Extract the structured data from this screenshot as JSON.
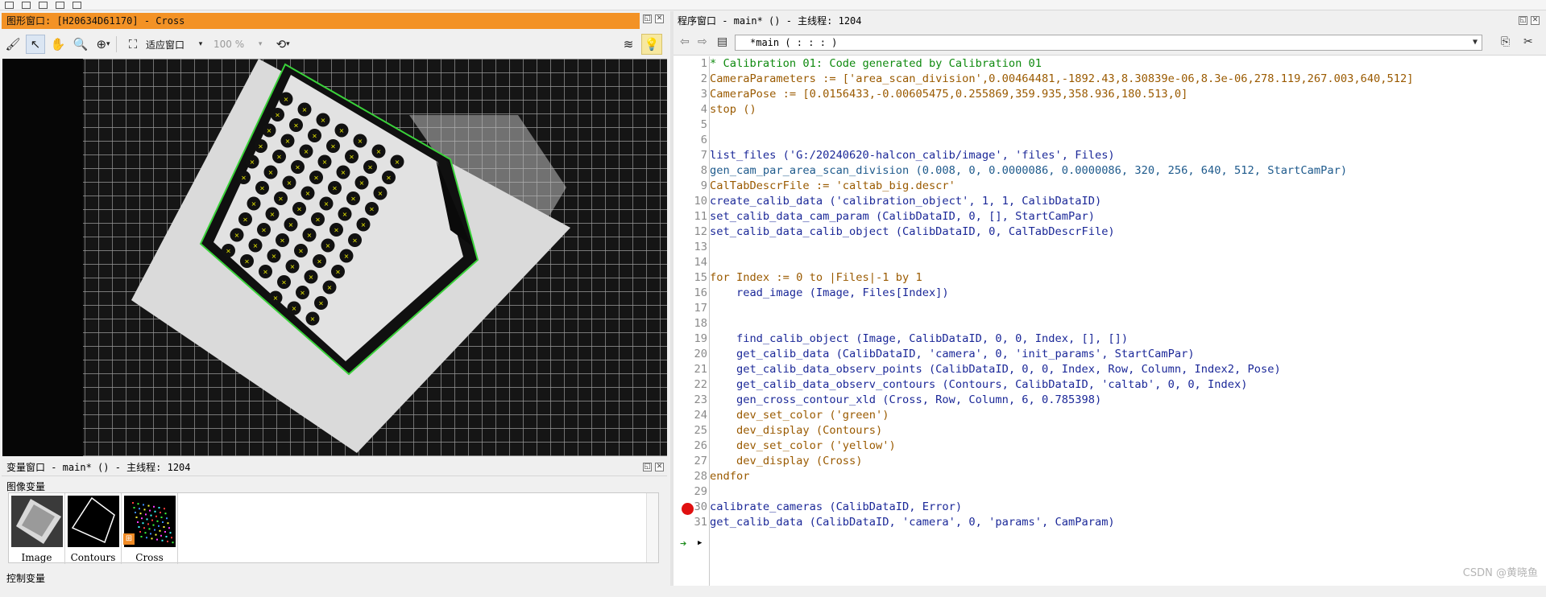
{
  "graphics_window": {
    "title": "图形窗口: [H20634D61170] - Cross",
    "fit_label": "适应窗口",
    "zoom_label": "100 %",
    "colors": {
      "title_bg": "#f39225",
      "outline": "#3ad23a",
      "marker": "#f2f200"
    }
  },
  "variable_window": {
    "title": "变量窗口 - main* () - 主线程: 1204",
    "section_image": "图像变量",
    "section_control": "控制变量",
    "items": [
      {
        "label": "Image"
      },
      {
        "label": "Contours"
      },
      {
        "label": "Cross"
      }
    ]
  },
  "program_window": {
    "title": "程序窗口 - main* () - 主线程: 1204",
    "procedure": "*main ( : : : )",
    "lines": [
      {
        "n": "1",
        "type": "comment",
        "text": "* Calibration 01: Code generated by Calibration 01"
      },
      {
        "n": "2",
        "type": "ctrl",
        "text": "CameraParameters := ['area_scan_division',0.00464481,-1892.43,8.30839e-06,8.3e-06,278.119,267.003,640,512]"
      },
      {
        "n": "3",
        "type": "ctrl",
        "text": "CameraPose := [0.0156433,-0.00605475,0.255869,359.935,358.936,180.513,0]"
      },
      {
        "n": "4",
        "type": "ctrl",
        "text": "stop ()"
      },
      {
        "n": "5",
        "type": "op",
        "text": ""
      },
      {
        "n": "6",
        "type": "op",
        "text": ""
      },
      {
        "n": "7",
        "type": "op",
        "text": "list_files ('G:/20240620-halcon_calib/image', 'files', Files)"
      },
      {
        "n": "8",
        "type": "norm",
        "text": "gen_cam_par_area_scan_division (0.008, 0, 0.0000086, 0.0000086, 320, 256, 640, 512, StartCamPar)"
      },
      {
        "n": "9",
        "type": "ctrl",
        "text": "CalTabDescrFile := 'caltab_big.descr'"
      },
      {
        "n": "10",
        "type": "op",
        "text": "create_calib_data ('calibration_object', 1, 1, CalibDataID)"
      },
      {
        "n": "11",
        "type": "op",
        "text": "set_calib_data_cam_param (CalibDataID, 0, [], StartCamPar)"
      },
      {
        "n": "12",
        "type": "op",
        "text": "set_calib_data_calib_object (CalibDataID, 0, CalTabDescrFile)"
      },
      {
        "n": "13",
        "type": "op",
        "text": ""
      },
      {
        "n": "14",
        "type": "op",
        "text": ""
      },
      {
        "n": "15",
        "type": "ctrl",
        "text": "for Index := 0 to |Files|-1 by 1"
      },
      {
        "n": "16",
        "type": "op",
        "text": "    read_image (Image, Files[Index])"
      },
      {
        "n": "17",
        "type": "op",
        "text": ""
      },
      {
        "n": "18",
        "type": "op",
        "text": ""
      },
      {
        "n": "19",
        "type": "op",
        "text": "    find_calib_object (Image, CalibDataID, 0, 0, Index, [], [])"
      },
      {
        "n": "20",
        "type": "op",
        "text": "    get_calib_data (CalibDataID, 'camera', 0, 'init_params', StartCamPar)"
      },
      {
        "n": "21",
        "type": "op",
        "text": "    get_calib_data_observ_points (CalibDataID, 0, 0, Index, Row, Column, Index2, Pose)"
      },
      {
        "n": "22",
        "type": "op",
        "text": "    get_calib_data_observ_contours (Contours, CalibDataID, 'caltab', 0, 0, Index)"
      },
      {
        "n": "23",
        "type": "op",
        "text": "    gen_cross_contour_xld (Cross, Row, Column, 6, 0.785398)"
      },
      {
        "n": "24",
        "type": "ctrl",
        "text": "    dev_set_color ('green')"
      },
      {
        "n": "25",
        "type": "ctrl",
        "text": "    dev_display (Contours)"
      },
      {
        "n": "26",
        "type": "ctrl",
        "text": "    dev_set_color ('yellow')"
      },
      {
        "n": "27",
        "type": "ctrl",
        "text": "    dev_display (Cross)"
      },
      {
        "n": "28",
        "type": "ctrl",
        "text": "endfor"
      },
      {
        "n": "29",
        "type": "op",
        "text": ""
      },
      {
        "n": "30",
        "type": "op",
        "text": "calibrate_cameras (CalibDataID, Error)"
      },
      {
        "n": "31",
        "type": "op",
        "text": "get_calib_data (CalibDataID, 'camera', 0, 'params', CamParam)"
      }
    ],
    "breakpoint_line": "30",
    "watermark": "CSDN @黄晓鱼"
  },
  "icons": [
    "clear-icon",
    "pointer-icon",
    "pan-hand-icon",
    "zoom-icon",
    "zoom-in-icon",
    "fit-window-icon",
    "layers-icon",
    "lightbulb-icon",
    "back-arrow-icon",
    "forward-arrow-icon",
    "procedure-icon",
    "insert-icon",
    "cut-icon"
  ]
}
